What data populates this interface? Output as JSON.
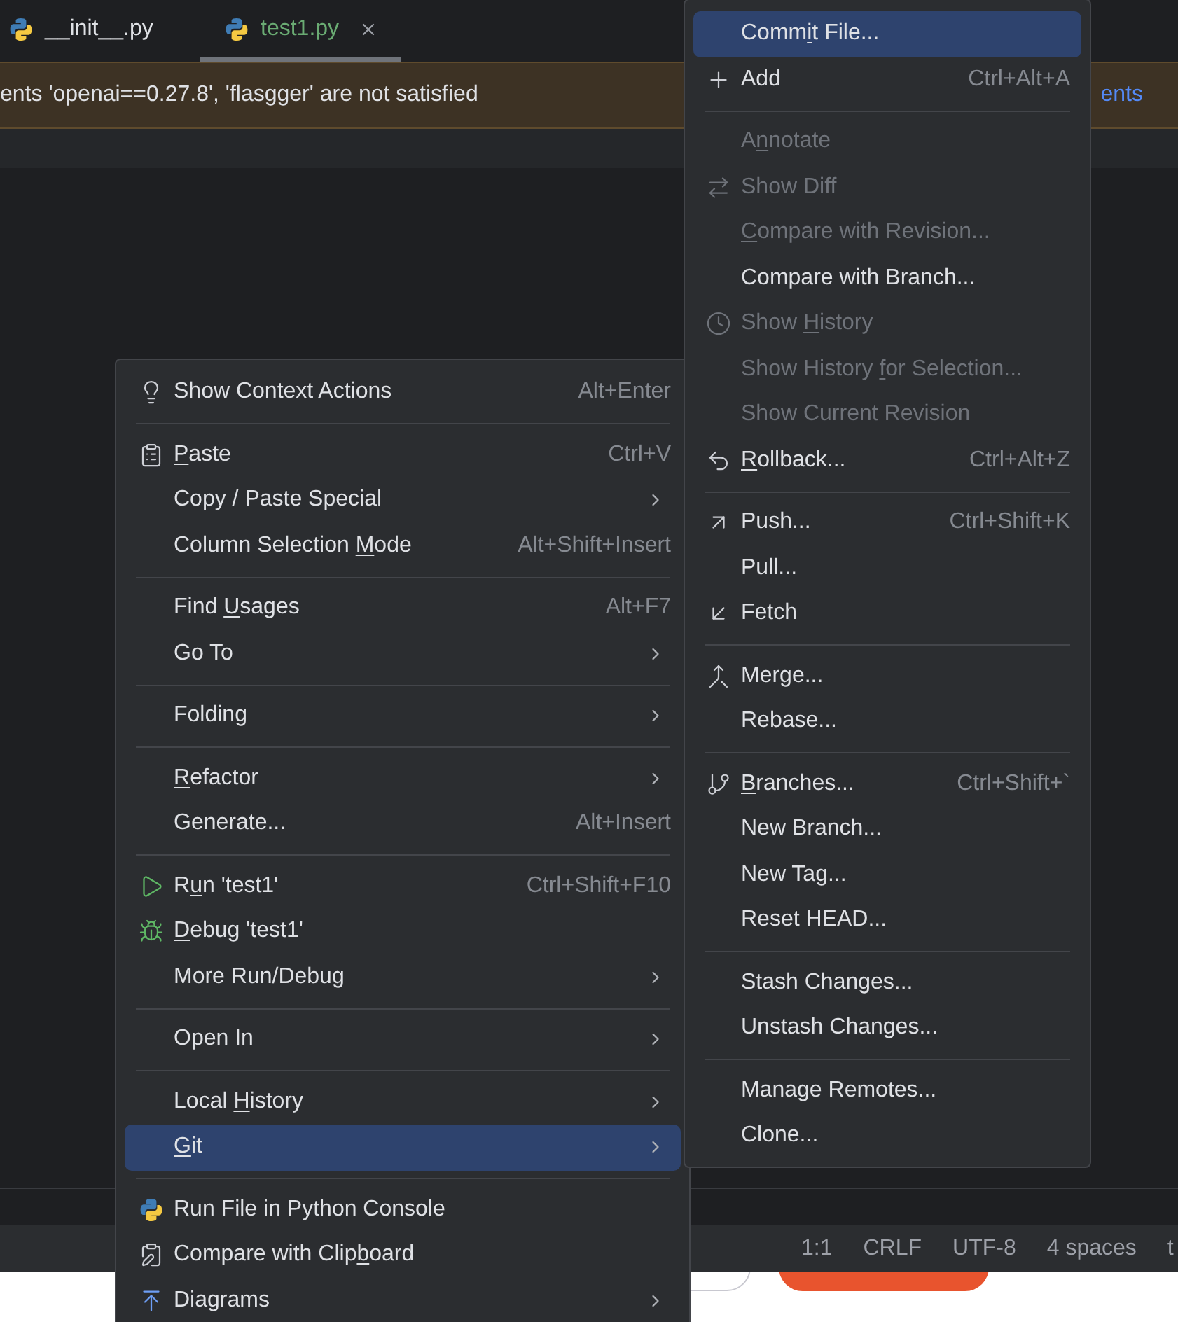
{
  "tabs": [
    {
      "label": "__init__.py",
      "selected": false
    },
    {
      "label": "test1.py",
      "selected": true
    }
  ],
  "banner": {
    "message": "ents 'openai==0.27.8', 'flasgger' are not satisfied",
    "link": "ents"
  },
  "status_bar": [
    "1:1",
    "CRLF",
    "UTF-8",
    "4 spaces",
    "t"
  ],
  "context_menu": {
    "sections": [
      {
        "items": [
          {
            "label": "Show Context Actions",
            "shortcut": "Alt+Enter",
            "selected": false
          }
        ]
      },
      {
        "items": [
          {
            "label_parts": {
              "key": "P",
              "post": "aste"
            },
            "shortcut": "Ctrl+V",
            "selected": false
          },
          {
            "label": "Copy / Paste Special",
            "submenu": true,
            "selected": false
          },
          {
            "label_parts": {
              "pre": "Column Selection ",
              "key": "M",
              "post": "ode"
            },
            "shortcut": "Alt+Shift+Insert",
            "selected": false
          }
        ]
      },
      {
        "items": [
          {
            "label_parts": {
              "pre": "Find ",
              "key": "U",
              "post": "sages"
            },
            "shortcut": "Alt+F7",
            "selected": false
          },
          {
            "label": "Go To",
            "submenu": true,
            "selected": false
          }
        ]
      },
      {
        "items": [
          {
            "label": "Folding",
            "submenu": true,
            "selected": false
          }
        ]
      },
      {
        "items": [
          {
            "label_parts": {
              "key": "R",
              "post": "efactor"
            },
            "submenu": true,
            "selected": false
          },
          {
            "label": "Generate...",
            "shortcut": "Alt+Insert",
            "selected": false
          }
        ]
      },
      {
        "items": [
          {
            "label_parts": {
              "pre": "R",
              "key": "u",
              "post": "n 'test1'"
            },
            "shortcut": "Ctrl+Shift+F10",
            "selected": false
          },
          {
            "label_parts": {
              "key": "D",
              "post": "ebug 'test1'"
            },
            "selected": false
          },
          {
            "label": "More Run/Debug",
            "submenu": true,
            "selected": false
          }
        ]
      },
      {
        "items": [
          {
            "label": "Open In",
            "submenu": true,
            "selected": false
          }
        ]
      },
      {
        "items": [
          {
            "label_parts": {
              "pre": "Local ",
              "key": "H",
              "post": "istory"
            },
            "submenu": true,
            "selected": false
          },
          {
            "label_parts": {
              "key": "G",
              "post": "it"
            },
            "submenu": true,
            "selected": true
          }
        ]
      },
      {
        "items": [
          {
            "label": "Run File in Python Console",
            "selected": false
          },
          {
            "label_parts": {
              "pre": "Compare with Clip",
              "key": "b",
              "post": "oard"
            },
            "selected": false
          },
          {
            "label": "Diagrams",
            "submenu": true,
            "selected": false
          }
        ]
      }
    ]
  },
  "git_menu": {
    "sections": [
      {
        "items": [
          {
            "label_parts": {
              "pre": "Comm",
              "key": "i",
              "post": "t File..."
            },
            "selected": true,
            "disabled": false
          },
          {
            "label": "Add",
            "shortcut": "Ctrl+Alt+A",
            "selected": false,
            "disabled": false
          }
        ]
      },
      {
        "items": [
          {
            "label_parts": {
              "pre": "A",
              "key": "n",
              "post": "notate"
            },
            "selected": false,
            "disabled": true
          },
          {
            "label": "Show Diff",
            "selected": false,
            "disabled": true
          },
          {
            "label_parts": {
              "key": "C",
              "post": "ompare with Revision..."
            },
            "selected": false,
            "disabled": true
          },
          {
            "label": "Compare with Branch...",
            "selected": false,
            "disabled": false
          },
          {
            "label_parts": {
              "pre": "Show ",
              "key": "H",
              "post": "istory"
            },
            "selected": false,
            "disabled": true
          },
          {
            "label_parts": {
              "pre": "Show History ",
              "key": "f",
              "post": "or Selection..."
            },
            "selected": false,
            "disabled": true
          },
          {
            "label": "Show Current Revision",
            "selected": false,
            "disabled": true
          },
          {
            "label_parts": {
              "key": "R",
              "post": "ollback..."
            },
            "shortcut": "Ctrl+Alt+Z",
            "selected": false,
            "disabled": false
          }
        ]
      },
      {
        "items": [
          {
            "label": "Push...",
            "shortcut": "Ctrl+Shift+K",
            "selected": false,
            "disabled": false
          },
          {
            "label": "Pull...",
            "selected": false,
            "disabled": false
          },
          {
            "label": "Fetch",
            "selected": false,
            "disabled": false
          }
        ]
      },
      {
        "items": [
          {
            "label": "Merge...",
            "selected": false,
            "disabled": false
          },
          {
            "label": "Rebase...",
            "selected": false,
            "disabled": false
          }
        ]
      },
      {
        "items": [
          {
            "label_parts": {
              "key": "B",
              "post": "ranches..."
            },
            "shortcut": "Ctrl+Shift+`",
            "selected": false,
            "disabled": false
          },
          {
            "label": "New Branch...",
            "selected": false,
            "disabled": false
          },
          {
            "label": "New Tag...",
            "selected": false,
            "disabled": false
          },
          {
            "label": "Reset HEAD...",
            "selected": false,
            "disabled": false
          }
        ]
      },
      {
        "items": [
          {
            "label": "Stash Changes...",
            "selected": false,
            "disabled": false
          },
          {
            "label": "Unstash Changes...",
            "selected": false,
            "disabled": false
          }
        ]
      },
      {
        "items": [
          {
            "label": "Manage Remotes...",
            "selected": false,
            "disabled": false
          },
          {
            "label": "Clone...",
            "selected": false,
            "disabled": false
          }
        ]
      }
    ]
  }
}
